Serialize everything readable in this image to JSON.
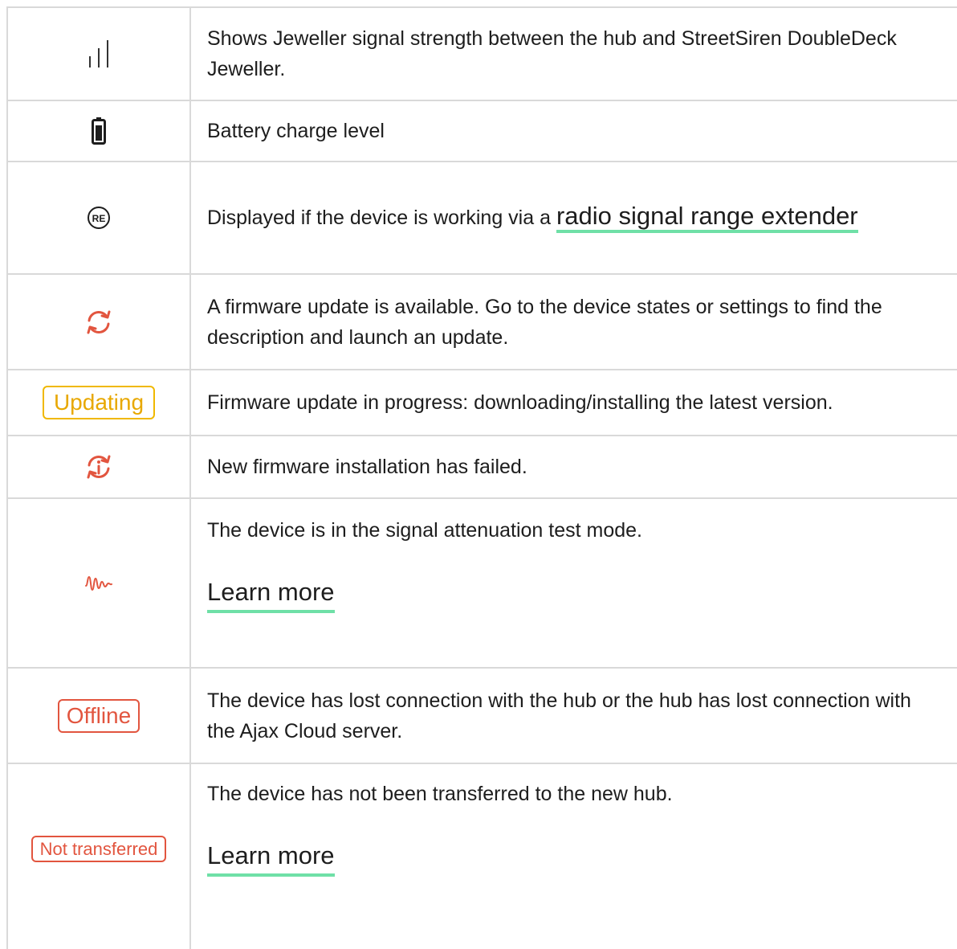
{
  "rows": [
    {
      "icon": "signal-strength-icon",
      "text": "Shows Jeweller signal strength between the hub and StreetSiren DoubleDeck Jeweller."
    },
    {
      "icon": "battery-icon",
      "text": "Battery charge level"
    },
    {
      "icon": "range-extender-icon",
      "text": "Displayed if the device is working via a ",
      "link": "radio signal range extender"
    },
    {
      "icon": "firmware-update-icon",
      "text": "A firmware update is available. Go to the device states or settings to find the description and launch an update."
    },
    {
      "badge": "Updating",
      "text": "Firmware update in progress: downloading/installing the latest version."
    },
    {
      "icon": "update-failed-icon",
      "text": "New firmware installation has failed."
    },
    {
      "icon": "attenuation-test-icon",
      "text": "The device is in the signal attenuation test mode.",
      "link": "Learn more"
    },
    {
      "badge": "Offline",
      "text": "The device has lost connection with the hub or the hub has lost connection with the Ajax Cloud server."
    },
    {
      "badge": "Not transferred",
      "text": "The device has not been transferred to the new hub.",
      "link": "Learn more"
    }
  ],
  "colors": {
    "accent_link": "#6fe0a7",
    "warning": "#f0b800",
    "error": "#e2553f",
    "border": "#d9d9d9"
  }
}
